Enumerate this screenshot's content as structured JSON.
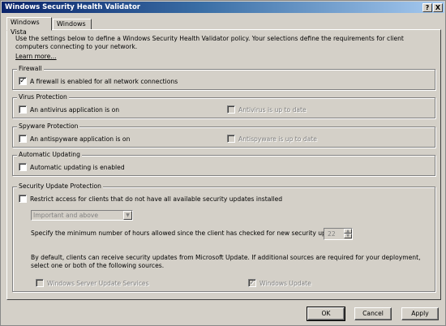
{
  "window": {
    "title": "Windows Security Health Validator",
    "help_label": "?",
    "close_label": "X"
  },
  "tabs": [
    {
      "label": "Windows Vista",
      "active": true
    },
    {
      "label": "Windows XP",
      "active": false
    }
  ],
  "intro": {
    "text": "Use the settings below to define a Windows Security Health Validator policy. Your selections define the requirements for client computers connecting to your network.",
    "learn_more": "Learn more..."
  },
  "firewall": {
    "title": "Firewall",
    "checkbox_label": "A firewall is enabled for all network connections",
    "checked": true
  },
  "virus": {
    "title": "Virus Protection",
    "checkbox_label": "An antivirus application is on",
    "uptodate_label": "Antivirus is up to date"
  },
  "spyware": {
    "title": "Spyware Protection",
    "checkbox_label": "An antispyware application is on",
    "uptodate_label": "Antispyware is up to date"
  },
  "updating": {
    "title": "Automatic Updating",
    "checkbox_label": "Automatic updating is enabled"
  },
  "security_updates": {
    "title": "Security Update Protection",
    "restrict_label": "Restrict access for clients that do not have all available security updates installed",
    "severity_value": "Important and above",
    "hours_label": "Specify the minimum number of hours allowed since the client has checked for new security updates:",
    "hours_value": "22",
    "sources_text": "By default, clients can receive security updates from Microsoft Update.  If additional sources are required for your deployment, select one or both of the following sources.",
    "wsus_label": "Windows Server Update Services",
    "windows_update_label": "Windows Update"
  },
  "buttons": {
    "ok": "OK",
    "cancel": "Cancel",
    "apply": "Apply"
  },
  "icons": {
    "check": "✓",
    "arrow_down": "▼",
    "arrow_up": "▲"
  }
}
